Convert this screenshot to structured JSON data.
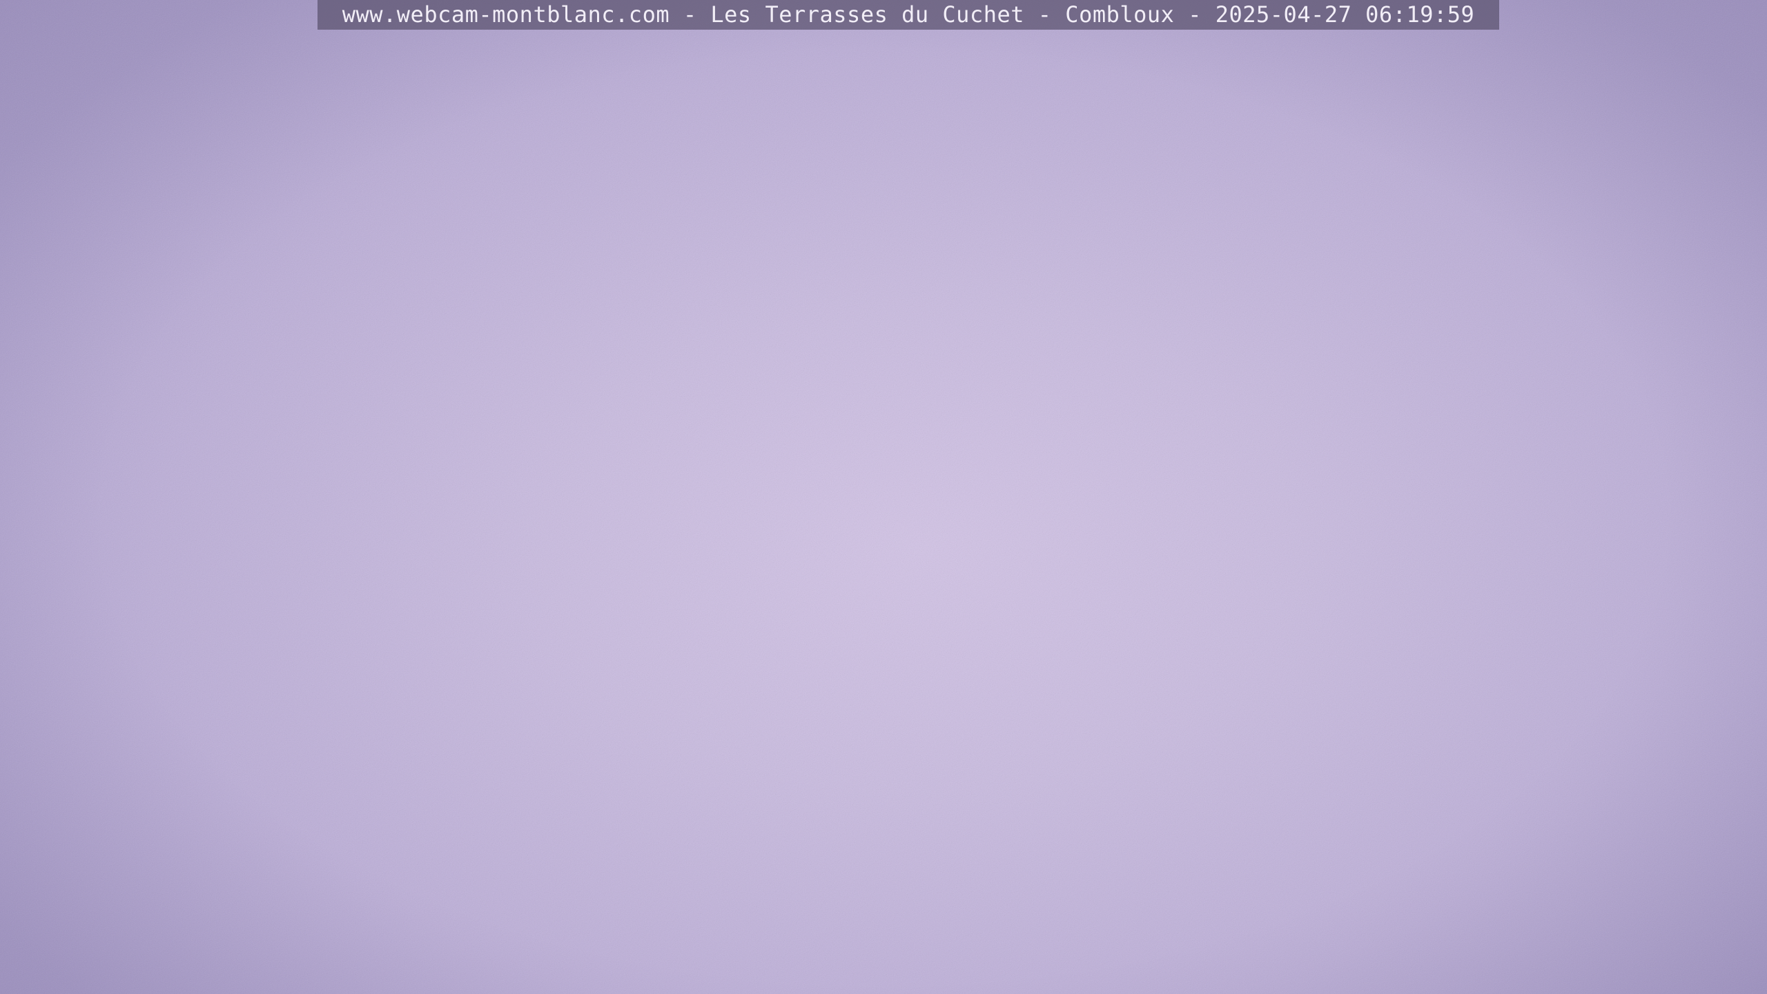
{
  "webcam": {
    "overlay_caption": "www.webcam-montblanc.com - Les Terrasses du Cuchet - Combloux - 2025-04-27 06:19:59",
    "sky_color": "#c8badf",
    "overlay_background": "#5a526e"
  }
}
